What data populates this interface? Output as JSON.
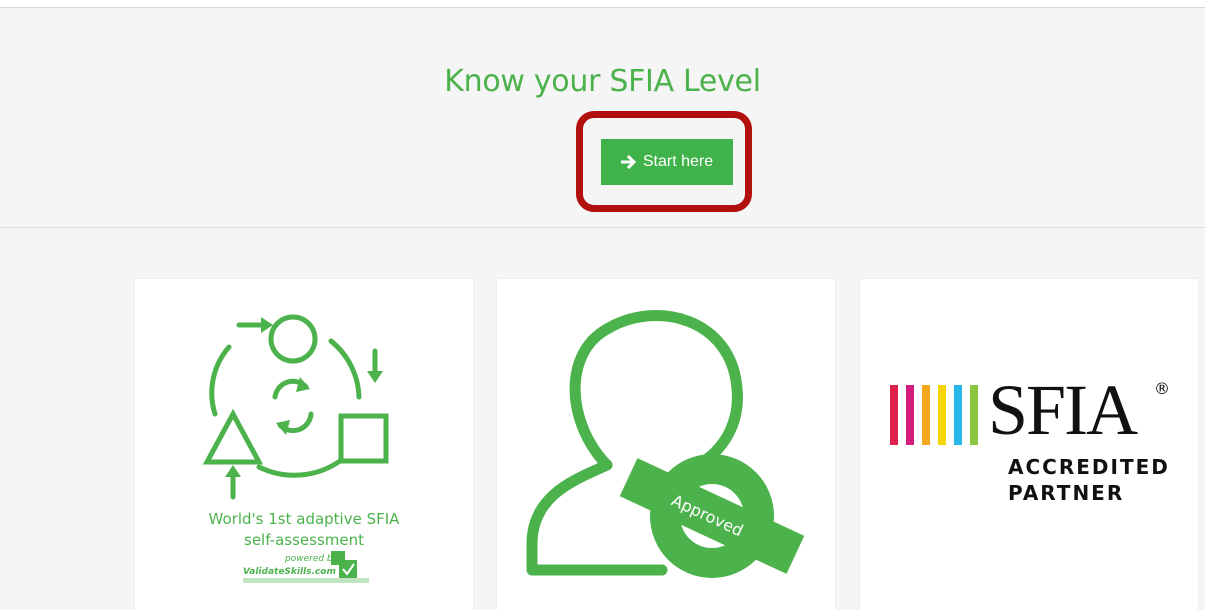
{
  "hero": {
    "title": "Know your SFIA Level",
    "start_button_label": "Start here"
  },
  "cards": {
    "assessment": {
      "line1": "World's 1st adaptive SFIA",
      "line2": "self-assessment",
      "powered_by": "powered by",
      "brand": "ValidateSkills.com"
    },
    "approved": {
      "stamp_label": "Approved"
    },
    "sfia": {
      "word": "SFIA",
      "registered": "®",
      "line1": "ACCREDITED",
      "line2": "PARTNER"
    }
  },
  "colors": {
    "brand_green": "#4cb24c",
    "button_green": "#3fb34a",
    "highlight_red": "#b20f0f",
    "sfia_stripes": [
      "#e11f4b",
      "#d61c7f",
      "#f4a81d",
      "#f5d400",
      "#29b6e8",
      "#8bc640"
    ]
  },
  "icons": [
    "arrow-right-icon",
    "cycle-shapes-icon",
    "approved-user-icon",
    "sfia-stripes-logo"
  ]
}
